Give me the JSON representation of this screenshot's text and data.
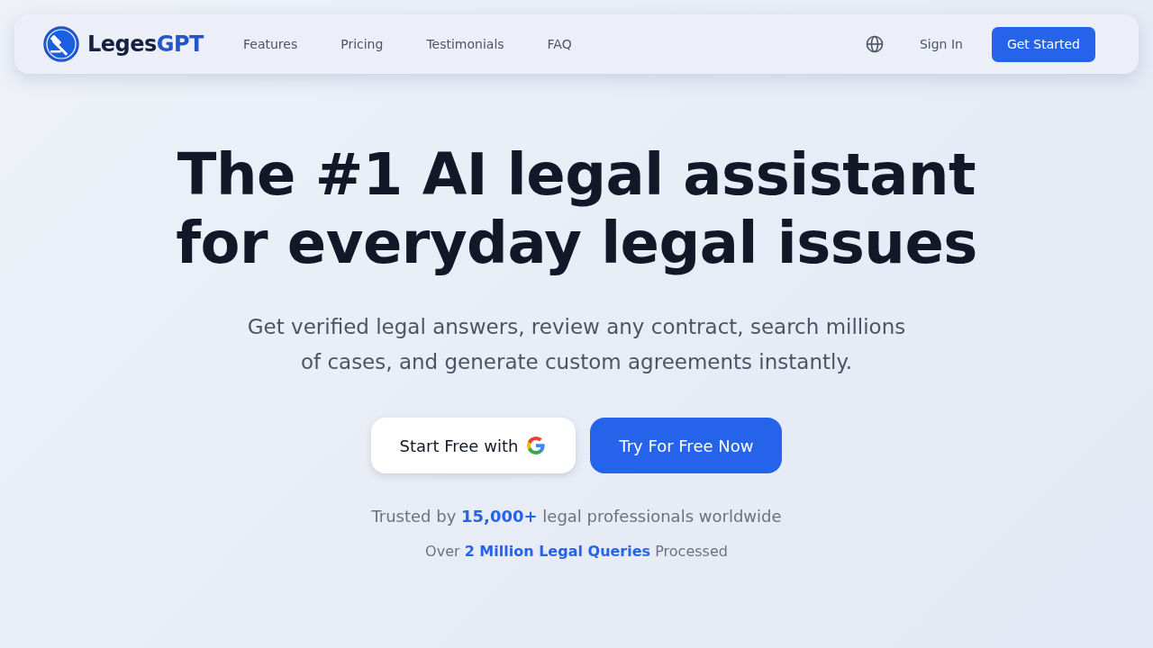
{
  "navbar": {
    "brand": {
      "first": "Leges",
      "second": "GPT"
    },
    "links": [
      {
        "label": "Features"
      },
      {
        "label": "Pricing"
      },
      {
        "label": "Testimonials"
      },
      {
        "label": "FAQ"
      }
    ],
    "sign_in": "Sign In",
    "get_started": "Get Started"
  },
  "hero": {
    "title_lines": [
      "The #1 AI legal assistant",
      "for everyday legal issues"
    ],
    "subtitle_lines": [
      "Get verified legal answers, review any contract, search millions",
      "of cases, and generate custom agreements instantly."
    ],
    "google_button": "Start Free with",
    "try_button": "Try For Free Now",
    "trust_line": "Trusted by **15,000+** legal professionals worldwide",
    "queries_line": "Over **2 Million Legal Queries** Processed"
  }
}
